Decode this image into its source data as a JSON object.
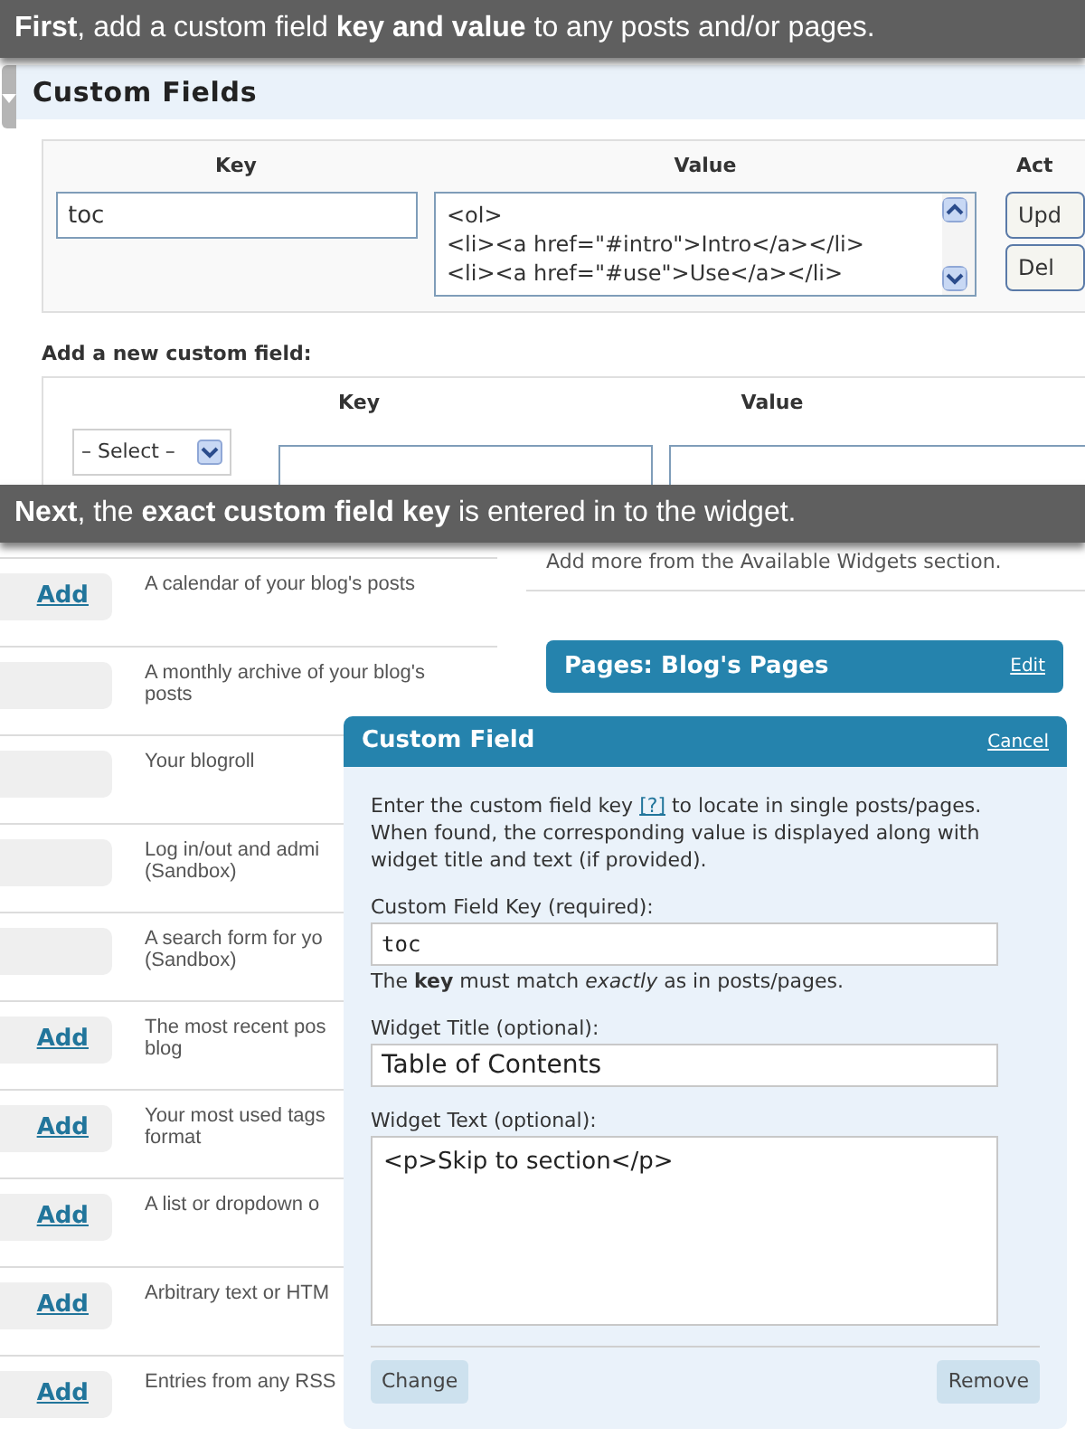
{
  "caption_top": "**First**, add a custom field **key and value** to any posts and/or pages.",
  "custom_fields": {
    "title": "Custom Fields",
    "columns": [
      "Key",
      "Value",
      "Act"
    ],
    "key": "toc",
    "value": "<ol>\n<li><a href=\"#intro\">Intro</a></li>\n<li><a href=\"#use\">Use</a></li>",
    "buttons": [
      "Upd",
      "Del"
    ],
    "add_new_label": "Add a new custom field:",
    "new_columns": [
      "Key",
      "Value"
    ],
    "select_label": "– Select –"
  },
  "caption_middle": "**Next**, the **exact custom field key** is entered in to the widget.",
  "widgets": [
    {
      "add": "Add",
      "description": [
        "A calendar of your blog's posts"
      ]
    },
    {
      "description": [
        "A monthly archive of your blog's",
        "posts"
      ]
    },
    {
      "description": [
        "Your blogroll"
      ]
    },
    {
      "description": [
        "Log in/out and admi",
        "(Sandbox)"
      ]
    },
    {
      "description": [
        "A search form for yo",
        "(Sandbox)"
      ]
    },
    {
      "add": "Add",
      "description": [
        "The most recent pos",
        "blog"
      ]
    },
    {
      "add": "Add",
      "description": [
        "Your most used tags",
        "format"
      ]
    },
    {
      "add": "Add",
      "description": [
        "A list or dropdown o"
      ]
    },
    {
      "add": "Add",
      "description": [
        "Arbitrary text or HTM"
      ]
    },
    {
      "add": "Add",
      "description": [
        "Entries from any RSS"
      ]
    }
  ],
  "available_note": "Add more from the Available Widgets section.",
  "pages_widget": {
    "title": "Pages: Blog's Pages",
    "action": "Edit"
  },
  "dialog": {
    "title": "Custom Field",
    "cancel": "Cancel",
    "intro_before": "Enter the custom field key ",
    "help_link": "[?]",
    "intro_after": " to locate in single posts/pages. When found, the corresponding value is displayed along with widget title and text (if provided).",
    "fields": [
      {
        "kind": "input",
        "label": "Custom Field Key (required):",
        "value": "toc",
        "hint": "The **key** must match *exactly* as in posts/pages."
      },
      {
        "kind": "input",
        "label": "Widget Title (optional):",
        "value": "Table of Contents"
      },
      {
        "kind": "textarea",
        "label": "Widget Text (optional):",
        "value": "<p>Skip to section</p>"
      }
    ],
    "buttons": [
      "Change",
      "Remove"
    ]
  }
}
